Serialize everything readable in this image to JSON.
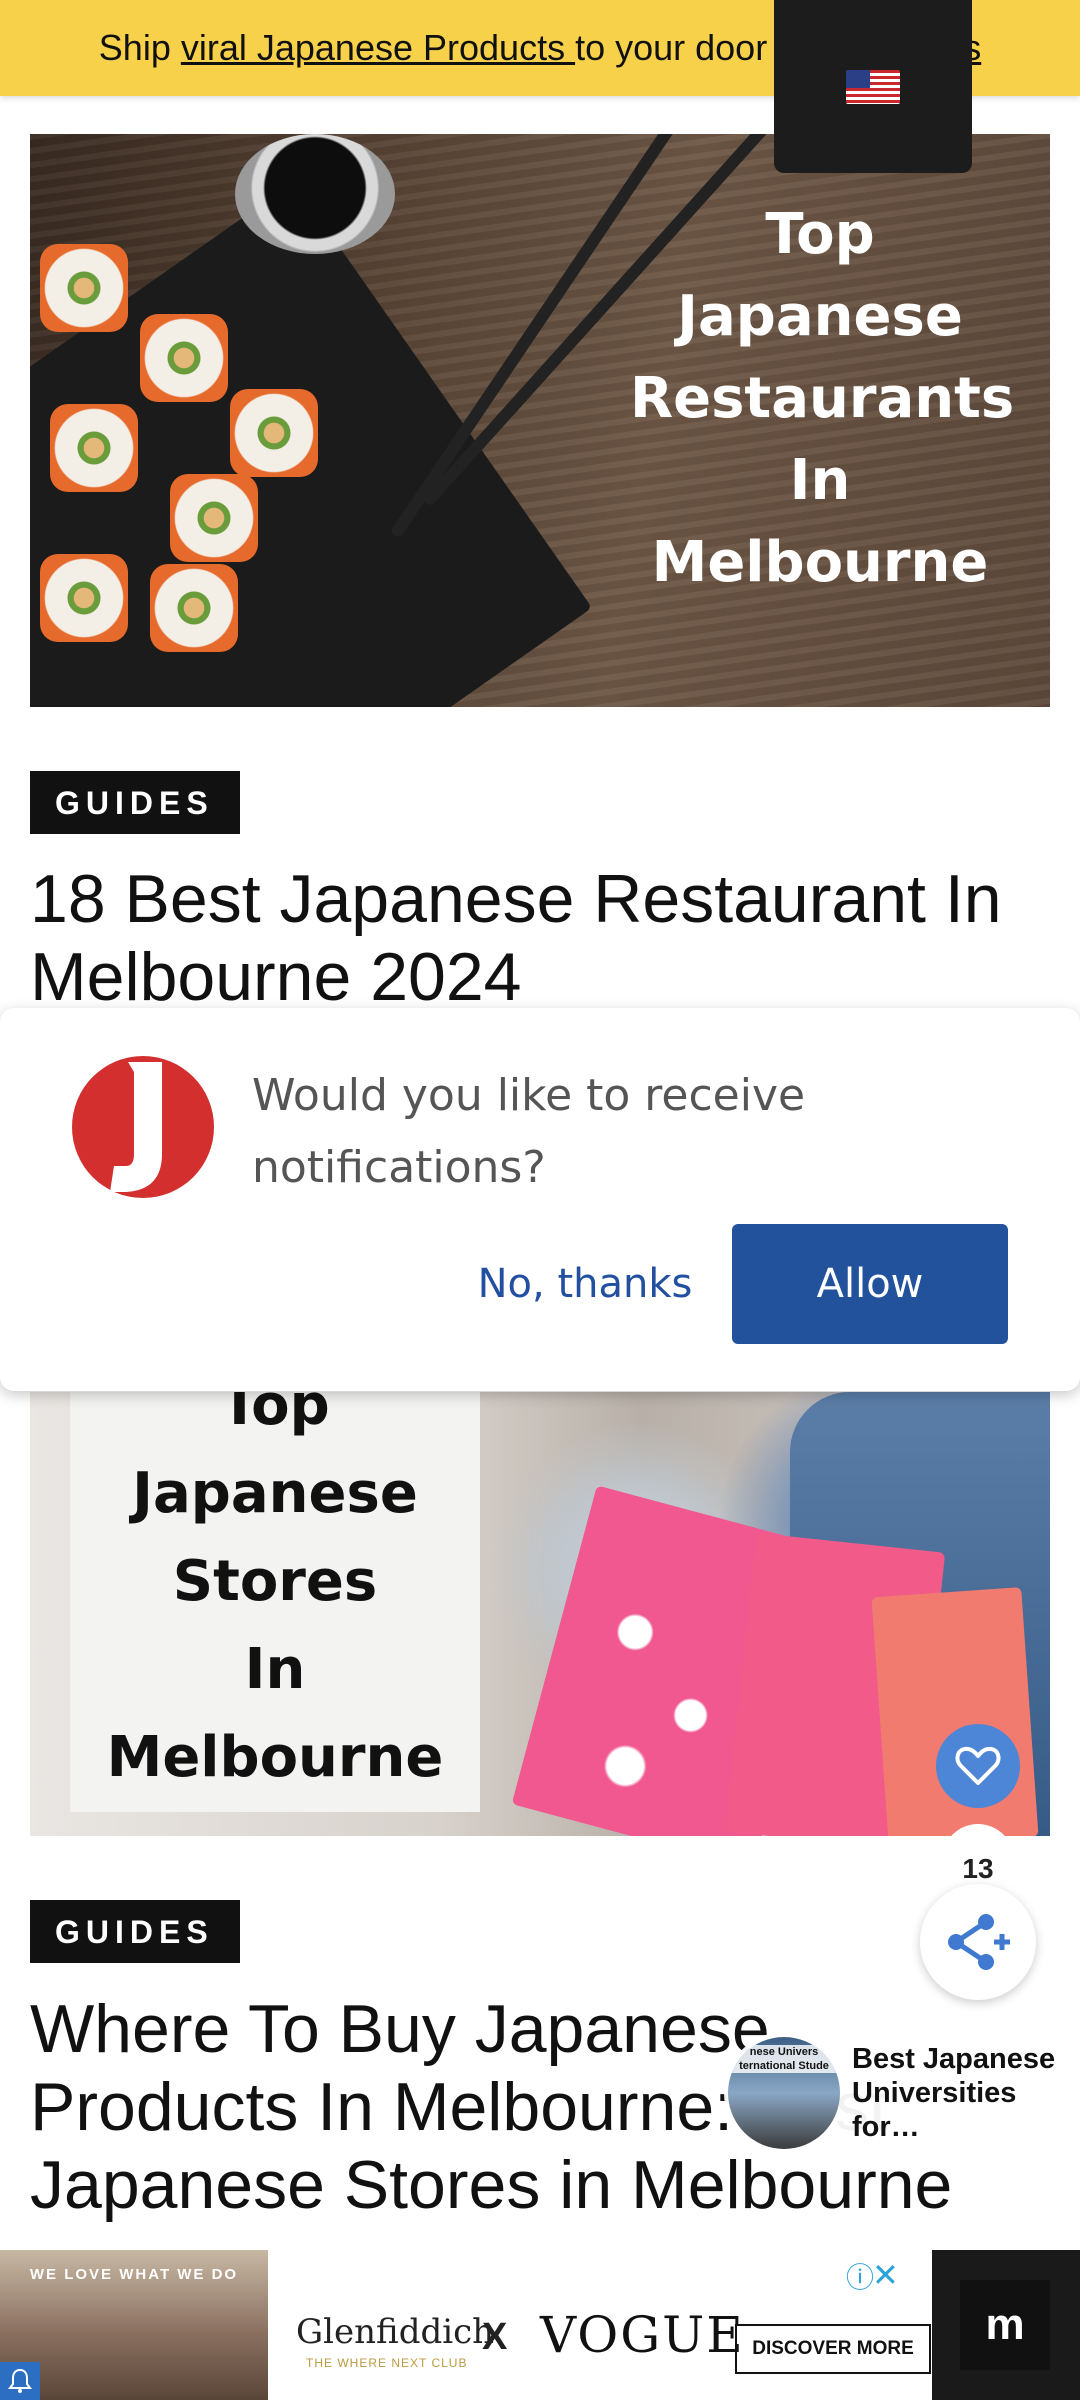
{
  "promo_bar": {
    "prefix": "Ship ",
    "link": "viral Japanese Products ",
    "suffix": "to your door",
    "tail": "iss"
  },
  "language_selector": {
    "flag": "us-flag-icon"
  },
  "articles": [
    {
      "image_overlay_lines": [
        "Top",
        "Japanese",
        "Restaurants",
        "In",
        "Melbourne"
      ],
      "category": "GUIDES",
      "title": "18 Best Japanese Restaurant In Melbourne 2024"
    },
    {
      "image_overlay_lines": [
        "Top",
        "Japanese",
        "Stores",
        "In",
        "Melbourne"
      ],
      "category": "GUIDES",
      "title": "Where To Buy Japanese Products In Melbourne: Best Japanese Stores in Melbourne"
    }
  ],
  "notification_prompt": {
    "message": "Would you like to receive notifications?",
    "decline_label": "No, thanks",
    "allow_label": "Allow"
  },
  "social": {
    "share_count": "13"
  },
  "recommended": {
    "title": "Best Japanese Universities for…",
    "thumb_text": "nese Univers\nternational Stude"
  },
  "ad": {
    "photo_tagline": "WE LOVE WHAT WE DO",
    "brand": "Glenfiddich.",
    "brand_sub": "THE WHERE NEXT CLUB",
    "x": "X",
    "partner": "VOGUE",
    "cta": "DISCOVER MORE"
  },
  "colors": {
    "promo_bg": "#f7d14a",
    "allow_bg": "#22529b",
    "decline_text": "#234fa0",
    "heart_fab": "#4d86d6",
    "badge_bg": "#111111",
    "logo_red": "#d32f2f"
  }
}
